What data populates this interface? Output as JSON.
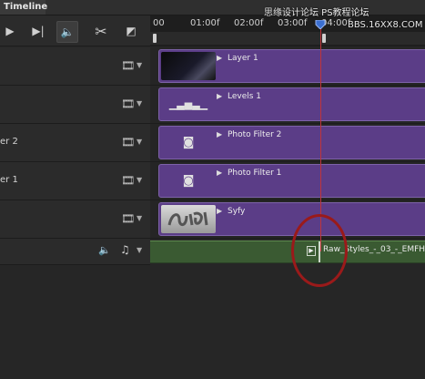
{
  "panel": {
    "title": "Timeline"
  },
  "ruler": {
    "ticks": [
      "00",
      "01:00f",
      "02:00f",
      "03:00f",
      "04:00f"
    ]
  },
  "tracks": [
    {
      "label": "",
      "clip": "Layer 1",
      "icon": "film-icon"
    },
    {
      "label": "",
      "clip": "Levels 1",
      "icon": "film-icon"
    },
    {
      "label": "er 2",
      "clip": "Photo Filter 2",
      "icon": "film-icon"
    },
    {
      "label": "er 1",
      "clip": "Photo Filter 1",
      "icon": "film-icon"
    },
    {
      "label": "",
      "clip": "Syfy",
      "icon": "film-icon"
    }
  ],
  "audio": {
    "clip": "Raw_Styles_-_03_-_EMFH"
  },
  "watermark": {
    "line1": "思缘设计论坛  PS教程论坛",
    "line2": "BBS.16XX8.COM"
  },
  "colors": {
    "clip": "#5b3d87",
    "audio": "#3a5a32",
    "playhead": "#c0343a",
    "annotation": "#9a1a1a"
  }
}
